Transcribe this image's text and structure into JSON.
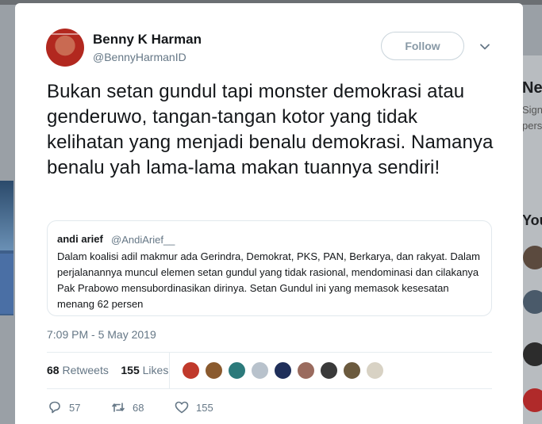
{
  "tweet": {
    "display_name": "Benny K Harman",
    "screen_name": "@BennyHarmanID",
    "follow_label": "Follow",
    "text": "Bukan setan gundul tapi monster demokrasi atau genderuwo, tangan-tangan kotor yang tidak kelihatan yang menjadi benalu demokrasi. Namanya benalu yah lama-lama makan tuannya sendiri!",
    "timestamp": "7:09 PM - 5 May 2019",
    "retweets_count": "68",
    "retweets_label": "Retweets",
    "likes_count": "155",
    "likes_label": "Likes"
  },
  "quoted": {
    "name": "andi arief",
    "handle": "@AndiArief__",
    "text": "Dalam koalisi adil makmur ada Gerindra, Demokrat, PKS, PAN, Berkarya, dan rakyat. Dalam perjalanannya  muncul elemen setan gundul yang tidak rasional, mendominasi dan cilakanya Pak Prabowo mensubordinasikan dirinya. Setan Gundul ini yang memasok kesesatan menang 62 persen"
  },
  "actions": {
    "reply_count": "57",
    "retweet_count": "68",
    "like_count": "155"
  },
  "background": {
    "right_title": "Ne",
    "right_line1": "Sign",
    "right_line2": "pers",
    "right_heading": "You"
  },
  "colors": {
    "secondary_text": "#657786",
    "border": "#e1e8ed",
    "follow_border": "#c9d4db"
  }
}
